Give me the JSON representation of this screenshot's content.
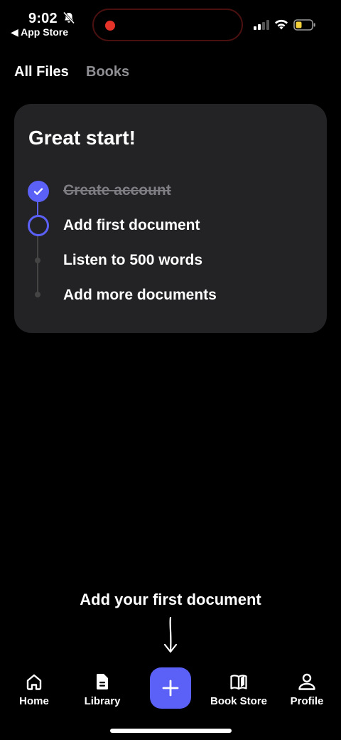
{
  "status_bar": {
    "time": "9:02",
    "back_app": "◀ App Store"
  },
  "tabs": [
    {
      "label": "All Files",
      "active": true
    },
    {
      "label": "Books",
      "active": false
    }
  ],
  "card": {
    "title": "Great start!",
    "steps": [
      {
        "label": "Create account",
        "state": "done"
      },
      {
        "label": "Add first document",
        "state": "current"
      },
      {
        "label": "Listen to 500 words",
        "state": "pending"
      },
      {
        "label": "Add more documents",
        "state": "pending"
      }
    ]
  },
  "hint": {
    "text": "Add your first document"
  },
  "bottom_nav": {
    "items": [
      {
        "label": "Home",
        "icon": "home-icon"
      },
      {
        "label": "Library",
        "icon": "document-icon"
      },
      {
        "label": "",
        "icon": "plus-icon"
      },
      {
        "label": "Book Store",
        "icon": "book-icon"
      },
      {
        "label": "Profile",
        "icon": "person-icon"
      }
    ]
  },
  "colors": {
    "accent": "#5b61f6",
    "card_bg": "#232326",
    "background": "#000000",
    "recording": "#e5332a"
  }
}
